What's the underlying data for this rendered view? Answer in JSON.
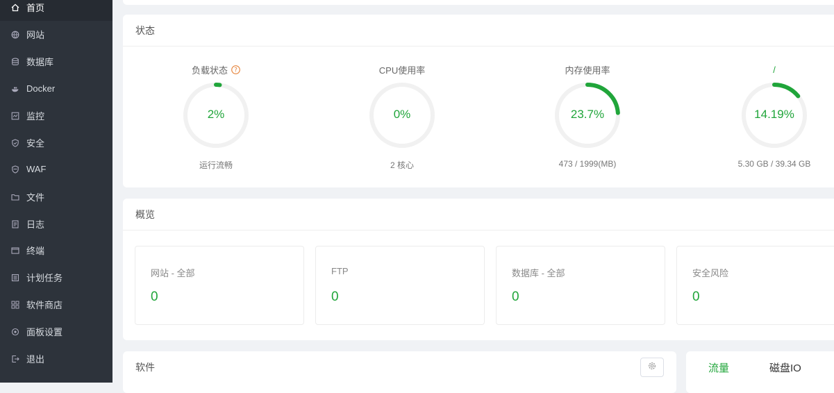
{
  "sidebar": {
    "items": [
      {
        "label": "首页",
        "icon": "home-icon"
      },
      {
        "label": "网站",
        "icon": "globe-icon"
      },
      {
        "label": "数据库",
        "icon": "database-icon"
      },
      {
        "label": "Docker",
        "icon": "docker-icon"
      },
      {
        "label": "监控",
        "icon": "monitor-icon"
      },
      {
        "label": "安全",
        "icon": "shield-icon"
      },
      {
        "label": "WAF",
        "icon": "waf-shield-icon"
      },
      {
        "label": "文件",
        "icon": "folder-icon"
      },
      {
        "label": "日志",
        "icon": "log-icon"
      },
      {
        "label": "终端",
        "icon": "terminal-icon"
      },
      {
        "label": "计划任务",
        "icon": "task-icon"
      },
      {
        "label": "软件商店",
        "icon": "store-icon"
      },
      {
        "label": "面板设置",
        "icon": "settings-icon"
      },
      {
        "label": "退出",
        "icon": "logout-icon"
      }
    ]
  },
  "status": {
    "title": "状态",
    "gauges": [
      {
        "label": "负载状态",
        "value": "2%",
        "percent": 2,
        "sub": "运行流畅"
      },
      {
        "label": "CPU使用率",
        "value": "0%",
        "percent": 0,
        "sub": "2 核心"
      },
      {
        "label": "内存使用率",
        "value": "23.7%",
        "percent": 23.7,
        "sub": "473 / 1999(MB)"
      },
      {
        "label": "/",
        "value": "14.19%",
        "percent": 14.19,
        "sub": "5.30 GB / 39.34 GB"
      }
    ]
  },
  "overview": {
    "title": "概览",
    "items": [
      {
        "title": "网站 - 全部",
        "value": "0"
      },
      {
        "title": "FTP",
        "value": "0"
      },
      {
        "title": "数据库 - 全部",
        "value": "0"
      },
      {
        "title": "安全风险",
        "value": "0"
      }
    ]
  },
  "software": {
    "title": "软件"
  },
  "traffic": {
    "tabs": [
      "流量",
      "磁盘IO"
    ]
  },
  "colors": {
    "accent": "#20a53a",
    "sidebar_bg": "#2d333b",
    "help": "#e6833a"
  }
}
